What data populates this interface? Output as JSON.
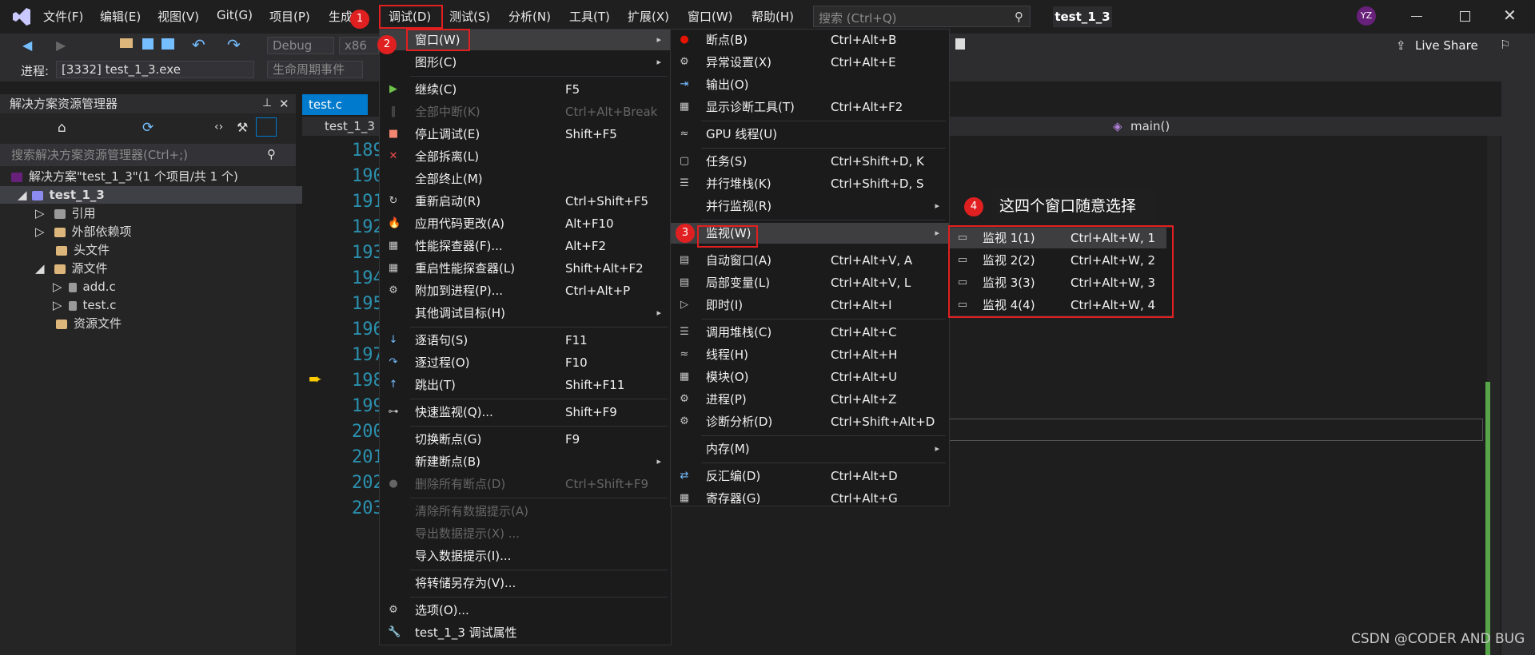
{
  "app": {
    "window_title": "test_1_3",
    "avatar_initials": "YZ",
    "live_share": "Live Share"
  },
  "menubar": [
    "文件(F)",
    "编辑(E)",
    "视图(V)",
    "Git(G)",
    "项目(P)",
    "生成",
    "调试(D)",
    "测试(S)",
    "分析(N)",
    "工具(T)",
    "扩展(X)",
    "窗口(W)",
    "帮助(H)"
  ],
  "search": {
    "placeholder": "搜索 (Ctrl+Q)"
  },
  "toolbar": {
    "config": "Debug",
    "platform": "x86",
    "process_label": "进程:",
    "process_value": "[3332] test_1_3.exe",
    "lifecycle": "生命周期事件"
  },
  "solution_explorer": {
    "title": "解决方案资源管理器",
    "search_placeholder": "搜索解决方案资源管理器(Ctrl+;)",
    "items": [
      {
        "label": "解决方案\"test_1_3\"(1 个项目/共 1 个)"
      },
      {
        "label": "test_1_3"
      },
      {
        "label": "引用"
      },
      {
        "label": "外部依赖项"
      },
      {
        "label": "头文件"
      },
      {
        "label": "源文件"
      },
      {
        "label": "add.c"
      },
      {
        "label": "test.c"
      },
      {
        "label": "资源文件"
      }
    ]
  },
  "editor": {
    "tab": "test.c",
    "project_tab": "test_1_3",
    "function": "main()",
    "line_numbers": [
      "189",
      "190",
      "191",
      "192",
      "193",
      "194",
      "195",
      "196",
      "197",
      "198",
      "199",
      "200",
      "201",
      "202",
      "203"
    ]
  },
  "debug_menu": {
    "items": [
      {
        "label": "窗口(W)",
        "shortcut": "",
        "sub": true
      },
      {
        "label": "图形(C)",
        "shortcut": "",
        "sub": true
      },
      {
        "label": "继续(C)",
        "shortcut": "F5"
      },
      {
        "label": "全部中断(K)",
        "shortcut": "Ctrl+Alt+Break",
        "disabled": true
      },
      {
        "label": "停止调试(E)",
        "shortcut": "Shift+F5"
      },
      {
        "label": "全部拆离(L)",
        "shortcut": ""
      },
      {
        "label": "全部终止(M)",
        "shortcut": ""
      },
      {
        "label": "重新启动(R)",
        "shortcut": "Ctrl+Shift+F5"
      },
      {
        "label": "应用代码更改(A)",
        "shortcut": "Alt+F10"
      },
      {
        "label": "性能探查器(F)...",
        "shortcut": "Alt+F2"
      },
      {
        "label": "重启性能探查器(L)",
        "shortcut": "Shift+Alt+F2"
      },
      {
        "label": "附加到进程(P)...",
        "shortcut": "Ctrl+Alt+P"
      },
      {
        "label": "其他调试目标(H)",
        "shortcut": "",
        "sub": true
      },
      {
        "label": "逐语句(S)",
        "shortcut": "F11"
      },
      {
        "label": "逐过程(O)",
        "shortcut": "F10"
      },
      {
        "label": "跳出(T)",
        "shortcut": "Shift+F11"
      },
      {
        "label": "快速监视(Q)...",
        "shortcut": "Shift+F9"
      },
      {
        "label": "切换断点(G)",
        "shortcut": "F9"
      },
      {
        "label": "新建断点(B)",
        "shortcut": "",
        "sub": true
      },
      {
        "label": "删除所有断点(D)",
        "shortcut": "Ctrl+Shift+F9",
        "disabled": true
      },
      {
        "label": "清除所有数据提示(A)",
        "shortcut": "",
        "disabled": true
      },
      {
        "label": "导出数据提示(X) ...",
        "shortcut": "",
        "disabled": true
      },
      {
        "label": "导入数据提示(I)...",
        "shortcut": ""
      },
      {
        "label": "将转储另存为(V)...",
        "shortcut": ""
      },
      {
        "label": "选项(O)...",
        "shortcut": ""
      },
      {
        "label": "test_1_3 调试属性",
        "shortcut": ""
      }
    ]
  },
  "window_menu": {
    "items": [
      {
        "label": "断点(B)",
        "shortcut": "Ctrl+Alt+B"
      },
      {
        "label": "异常设置(X)",
        "shortcut": "Ctrl+Alt+E"
      },
      {
        "label": "输出(O)",
        "shortcut": ""
      },
      {
        "label": "显示诊断工具(T)",
        "shortcut": "Ctrl+Alt+F2"
      },
      {
        "label": "GPU 线程(U)",
        "shortcut": ""
      },
      {
        "label": "任务(S)",
        "shortcut": "Ctrl+Shift+D, K"
      },
      {
        "label": "并行堆栈(K)",
        "shortcut": "Ctrl+Shift+D, S"
      },
      {
        "label": "并行监视(R)",
        "shortcut": "",
        "sub": true
      },
      {
        "label": "监视(W)",
        "shortcut": "",
        "sub": true
      },
      {
        "label": "自动窗口(A)",
        "shortcut": "Ctrl+Alt+V, A"
      },
      {
        "label": "局部变量(L)",
        "shortcut": "Ctrl+Alt+V, L"
      },
      {
        "label": "即时(I)",
        "shortcut": "Ctrl+Alt+I"
      },
      {
        "label": "调用堆栈(C)",
        "shortcut": "Ctrl+Alt+C"
      },
      {
        "label": "线程(H)",
        "shortcut": "Ctrl+Alt+H"
      },
      {
        "label": "模块(O)",
        "shortcut": "Ctrl+Alt+U"
      },
      {
        "label": "进程(P)",
        "shortcut": "Ctrl+Alt+Z"
      },
      {
        "label": "诊断分析(D)",
        "shortcut": "Ctrl+Shift+Alt+D"
      },
      {
        "label": "内存(M)",
        "shortcut": "",
        "sub": true
      },
      {
        "label": "反汇编(D)",
        "shortcut": "Ctrl+Alt+D"
      },
      {
        "label": "寄存器(G)",
        "shortcut": "Ctrl+Alt+G"
      }
    ]
  },
  "watch_menu": {
    "items": [
      {
        "label": "监视 1(1)",
        "shortcut": "Ctrl+Alt+W, 1"
      },
      {
        "label": "监视 2(2)",
        "shortcut": "Ctrl+Alt+W, 2"
      },
      {
        "label": "监视 3(3)",
        "shortcut": "Ctrl+Alt+W, 3"
      },
      {
        "label": "监视 4(4)",
        "shortcut": "Ctrl+Alt+W, 4"
      }
    ]
  },
  "annotations": {
    "badges": [
      "1",
      "2",
      "3",
      "4"
    ],
    "callout": "这四个窗口随意选择"
  },
  "watermark": "CSDN @CODER AND BUG",
  "colors": {
    "accent": "#007acc",
    "annotation_red": "#e02020",
    "menu_bg": "#1b1b1c"
  }
}
